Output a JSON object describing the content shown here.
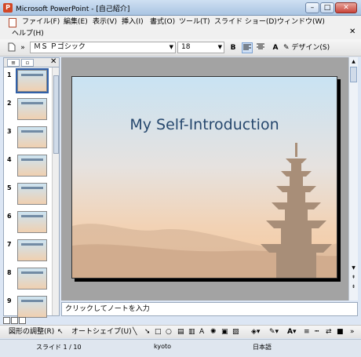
{
  "window": {
    "title": "Microsoft PowerPoint - [自己紹介]",
    "minimize": "–",
    "maximize": "□",
    "close": "✕"
  },
  "menu": {
    "items": [
      "ファイル(F)",
      "編集(E)",
      "表示(V)",
      "挿入(I)",
      "書式(O)",
      "ツール(T)",
      "スライド ショー(D)",
      "ウィンドウ(W)"
    ],
    "help": "ヘルプ(H)",
    "help_search_placeholder": "",
    "close": "✕"
  },
  "toolbar": {
    "font_name": "ＭＳ Ｐゴシック",
    "font_size": "18",
    "bold": "B",
    "design_label": "デザイン(S)"
  },
  "outline": {
    "slides": [
      {
        "num": "1",
        "selected": true
      },
      {
        "num": "2",
        "selected": false
      },
      {
        "num": "3",
        "selected": false
      },
      {
        "num": "4",
        "selected": false
      },
      {
        "num": "5",
        "selected": false
      },
      {
        "num": "6",
        "selected": false
      },
      {
        "num": "7",
        "selected": false
      },
      {
        "num": "8",
        "selected": false
      },
      {
        "num": "9",
        "selected": false
      }
    ]
  },
  "slide": {
    "title": "My Self-Introduction"
  },
  "notes": {
    "placeholder": "クリックしてノートを入力"
  },
  "drawing": {
    "adjust": "図形の調整(R)",
    "autoshape": "オートシェイプ(U)"
  },
  "status": {
    "slide": "スライド 1 / 10",
    "design": "kyoto",
    "language": "日本語"
  },
  "colors": {
    "title_text": "#27486e",
    "pagoda": "#a88e78"
  }
}
